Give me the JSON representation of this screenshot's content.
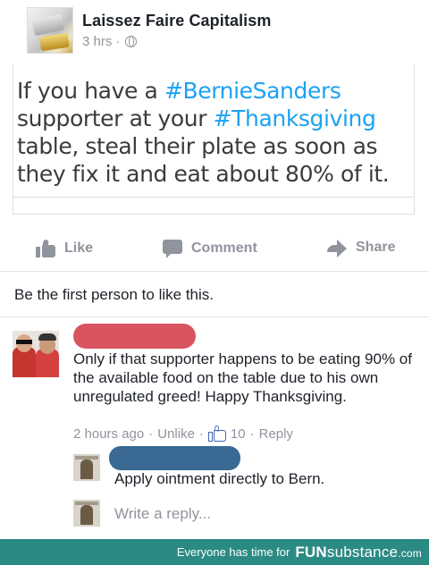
{
  "post": {
    "page_name": "Laissez Faire Capitalism",
    "time": "3 hrs",
    "separator": "·"
  },
  "shared": {
    "text_1": "If you have a ",
    "hashtag_1": "#BernieSanders",
    "text_2": " supporter at your ",
    "hashtag_2": "#Thanksgiving",
    "text_3": " table, steal their plate as soon as they fix it and eat about 80% of it.",
    "hashtag_color": "#1da1f2"
  },
  "actions": {
    "like": "Like",
    "comment": "Comment",
    "share": "Share"
  },
  "likes_summary": "Be the first person to like this.",
  "comment": {
    "text": "Only if that supporter happens to be eating 90% of the available food on the table due to his own unregulated greed! Happy Thanksgiving.",
    "time": "2 hours ago",
    "sep": "·",
    "unlike": "Unlike",
    "like_count": "10",
    "reply": "Reply"
  },
  "reply": {
    "text": "Apply ointment directly to Bern."
  },
  "write_reply_placeholder": "Write a reply...",
  "footer": {
    "tagline": "Everyone has time for",
    "brand_bold": "FUN",
    "brand_rest": "substance",
    "brand_tld": ".com"
  },
  "colors": {
    "redaction_red": "#d9545f",
    "redaction_blue": "#3a6a94",
    "footer_bg": "#2b8b84",
    "facebook_blue": "#4267b2"
  }
}
